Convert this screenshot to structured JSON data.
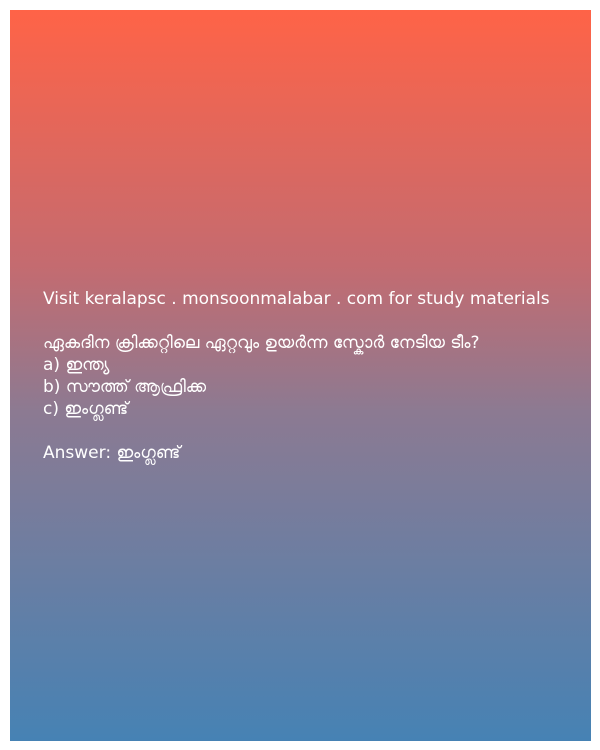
{
  "header": {
    "visit_line": "Visit keralapsc . monsoonmalabar . com for study materials"
  },
  "question": {
    "text": " ഏകദിന ക്രിക്കറ്റിലെ ഏറ്റവും ഉയർന്ന സ്കോർ നേടിയ ടീം?",
    "options": [
      "a) ഇന്ത്യ",
      "b) സൗത്ത് ആഫ്രിക്ക",
      "c) ഇംഗ്ലണ്ട്"
    ]
  },
  "answer": {
    "text": "Answer: ഇംഗ്ലണ്ട്"
  }
}
